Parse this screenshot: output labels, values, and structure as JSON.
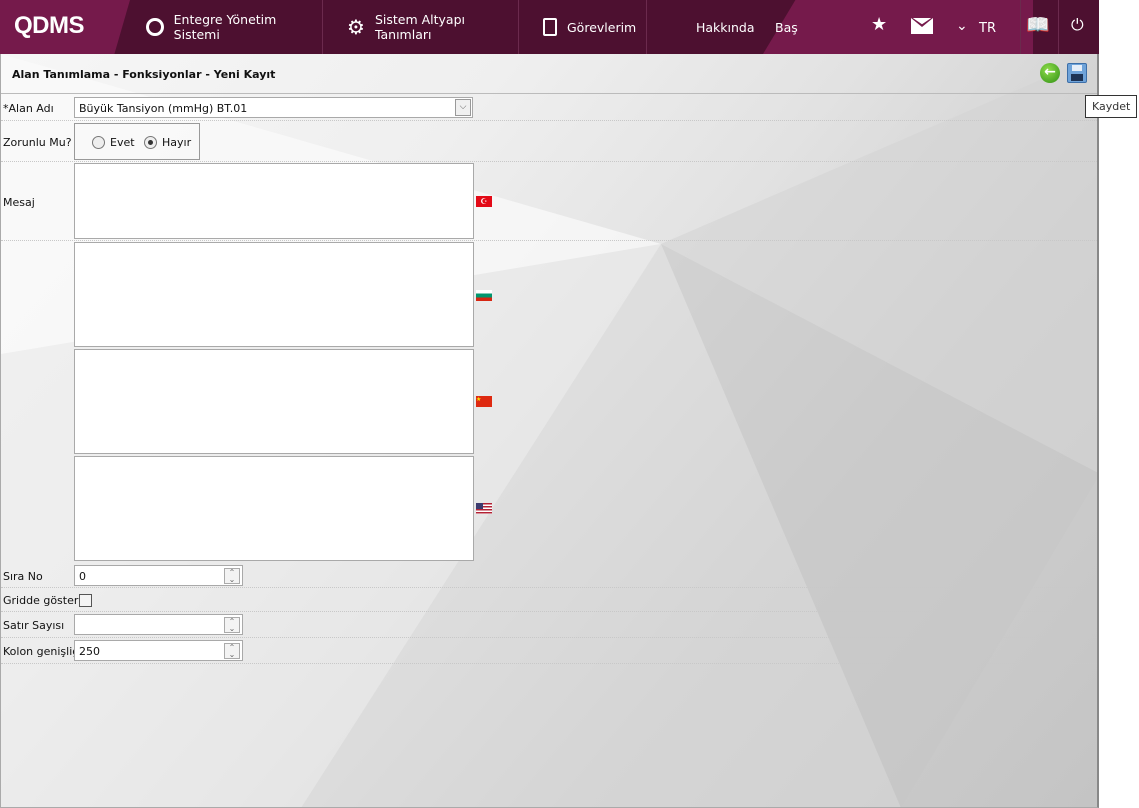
{
  "header": {
    "logo": "QDMS",
    "nav": [
      {
        "label": "Entegre Yönetim Sistemi",
        "icon": "q-logo-icon"
      },
      {
        "label": "Sistem Altyapı Tanımları",
        "icon": "gear-icon"
      },
      {
        "label": "Görevlerim",
        "icon": "clipboard-icon"
      }
    ],
    "about": "Hakkında",
    "start": "Baş",
    "language": "TR",
    "icons": [
      "star-icon",
      "mail-icon",
      "chevron-down-icon",
      "manual-book-icon",
      "power-icon"
    ]
  },
  "page": {
    "title": "Alan Tanımlama - Fonksiyonlar - Yeni Kayıt",
    "tooltip": "Kaydet"
  },
  "form": {
    "alan_adi_label": "*Alan Adı",
    "alan_adi_value": "Büyük Tansiyon (mmHg)  BT.01",
    "zorunlu_label": "Zorunlu Mu?",
    "evet": "Evet",
    "hayir": "Hayır",
    "zorunlu_selected": "Hayır",
    "mesaj_label": "Mesaj",
    "mesaj_languages": [
      "Türkçe",
      "Bulgarca",
      "Çince",
      "İngilizce"
    ],
    "sira_no_label": "Sıra No",
    "sira_no_value": "0",
    "gridde_label": "Gridde göster",
    "gridde_checked": false,
    "satir_label": "Satır Sayısı",
    "satir_value": "",
    "kolon_label": "Kolon genişliği",
    "kolon_value": "250"
  },
  "colors": {
    "header_dark": "#4d1030",
    "header_light": "#751a4b"
  }
}
